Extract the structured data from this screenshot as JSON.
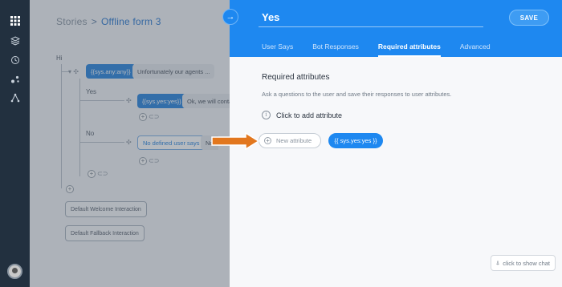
{
  "breadcrumb": {
    "root": "Stories",
    "separator": ">",
    "current": "Offline form 3"
  },
  "canvas": {
    "root_label": "Hi",
    "sys_any": "{{sys.any:any}}",
    "agent_reply": "Unfortunately our agents ...",
    "yes_label": "Yes",
    "sys_yes": "{{sys.yes:yes}}",
    "yes_reply": "Ok, we will contac",
    "no_label": "No",
    "no_defined": "No defined user says",
    "no_reply": "No",
    "default_welcome": "Default Welcome Interaction",
    "default_fallback": "Default Fallback Interaction"
  },
  "panel": {
    "title": "Yes",
    "save_label": "SAVE",
    "tabs": [
      {
        "label": "User Says"
      },
      {
        "label": "Bot Responses"
      },
      {
        "label": "Required attributes"
      },
      {
        "label": "Advanced"
      }
    ],
    "section_title": "Required attributes",
    "section_desc": "Ask a questions to the user and save their responses to user attributes.",
    "add_attribute": "Click to add attribute",
    "attr_placeholder": "New attribute",
    "attr_chip": "{{ sys.yes:yes }}",
    "chat_button": "click to show chat"
  },
  "colors": {
    "accent": "#1e88f0",
    "rail": "#22303f",
    "pointer": "#e2771e"
  },
  "icons": [
    "grid-icon",
    "layers-icon",
    "history-icon",
    "nodes-icon",
    "share-icon",
    "arrow-right-icon",
    "info-icon",
    "plus-icon",
    "chat-icon"
  ]
}
